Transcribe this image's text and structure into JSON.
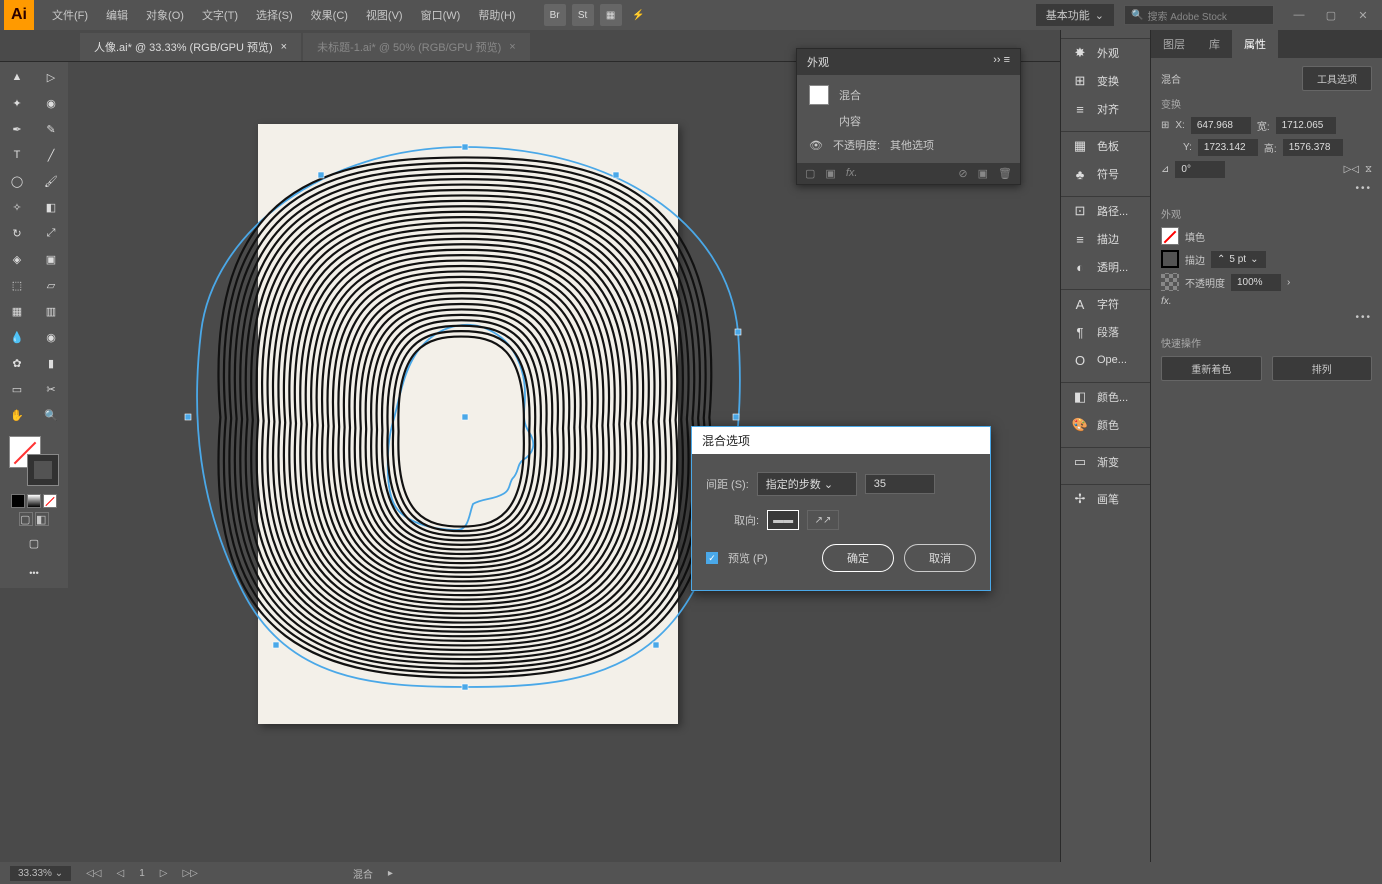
{
  "app": {
    "logo": "Ai"
  },
  "menu": [
    "文件(F)",
    "编辑",
    "对象(O)",
    "文字(T)",
    "选择(S)",
    "效果(C)",
    "视图(V)",
    "窗口(W)",
    "帮助(H)"
  ],
  "topbar": {
    "workspace": "基本功能",
    "search_placeholder": "搜索 Adobe Stock"
  },
  "tabs": [
    {
      "label": "人像.ai* @ 33.33% (RGB/GPU 预览)",
      "active": true
    },
    {
      "label": "未标题-1.ai* @ 50% (RGB/GPU 预览)",
      "active": false
    }
  ],
  "appearance_panel": {
    "title": "外观",
    "blend": "混合",
    "content": "内容",
    "opacity_label": "不透明度:",
    "opacity_value": "其他选项"
  },
  "panel_strip": [
    {
      "icon": "✸",
      "label": "外观"
    },
    {
      "icon": "⊞",
      "label": "变换"
    },
    {
      "icon": "≡",
      "label": "对齐"
    },
    {
      "icon": "▦",
      "label": "色板"
    },
    {
      "icon": "♣",
      "label": "符号"
    },
    {
      "icon": "⊡",
      "label": "路径..."
    },
    {
      "icon": "≡",
      "label": "描边"
    },
    {
      "icon": "◐",
      "label": "透明..."
    },
    {
      "icon": "A",
      "label": "字符"
    },
    {
      "icon": "¶",
      "label": "段落"
    },
    {
      "icon": "O",
      "label": "Ope..."
    },
    {
      "icon": "◧",
      "label": "颜色..."
    },
    {
      "icon": "🎨",
      "label": "颜色"
    },
    {
      "icon": "▭",
      "label": "渐变"
    },
    {
      "icon": "✢",
      "label": "画笔"
    }
  ],
  "prop_panel": {
    "tabs": [
      "图层",
      "库",
      "属性"
    ],
    "active_tab": 2,
    "object_type": "混合",
    "tool_options": "工具选项",
    "transform_label": "变换",
    "x": "647.968",
    "y": "1723.142",
    "w": "1712.065",
    "h": "1576.378",
    "rotate": "0°",
    "appearance_label": "外观",
    "fill_label": "填色",
    "stroke_label": "描边",
    "stroke_val": "5 pt",
    "opacity_label": "不透明度",
    "opacity_val": "100%",
    "quick_label": "快速操作",
    "recolor": "重新着色",
    "arrange": "排列"
  },
  "dialog": {
    "title": "混合选项",
    "spacing_label": "间距 (S):",
    "spacing_mode": "指定的步数",
    "spacing_value": "35",
    "orient_label": "取向:",
    "preview": "预览 (P)",
    "ok": "确定",
    "cancel": "取消"
  },
  "status": {
    "zoom": "33.33%",
    "object": "混合"
  }
}
